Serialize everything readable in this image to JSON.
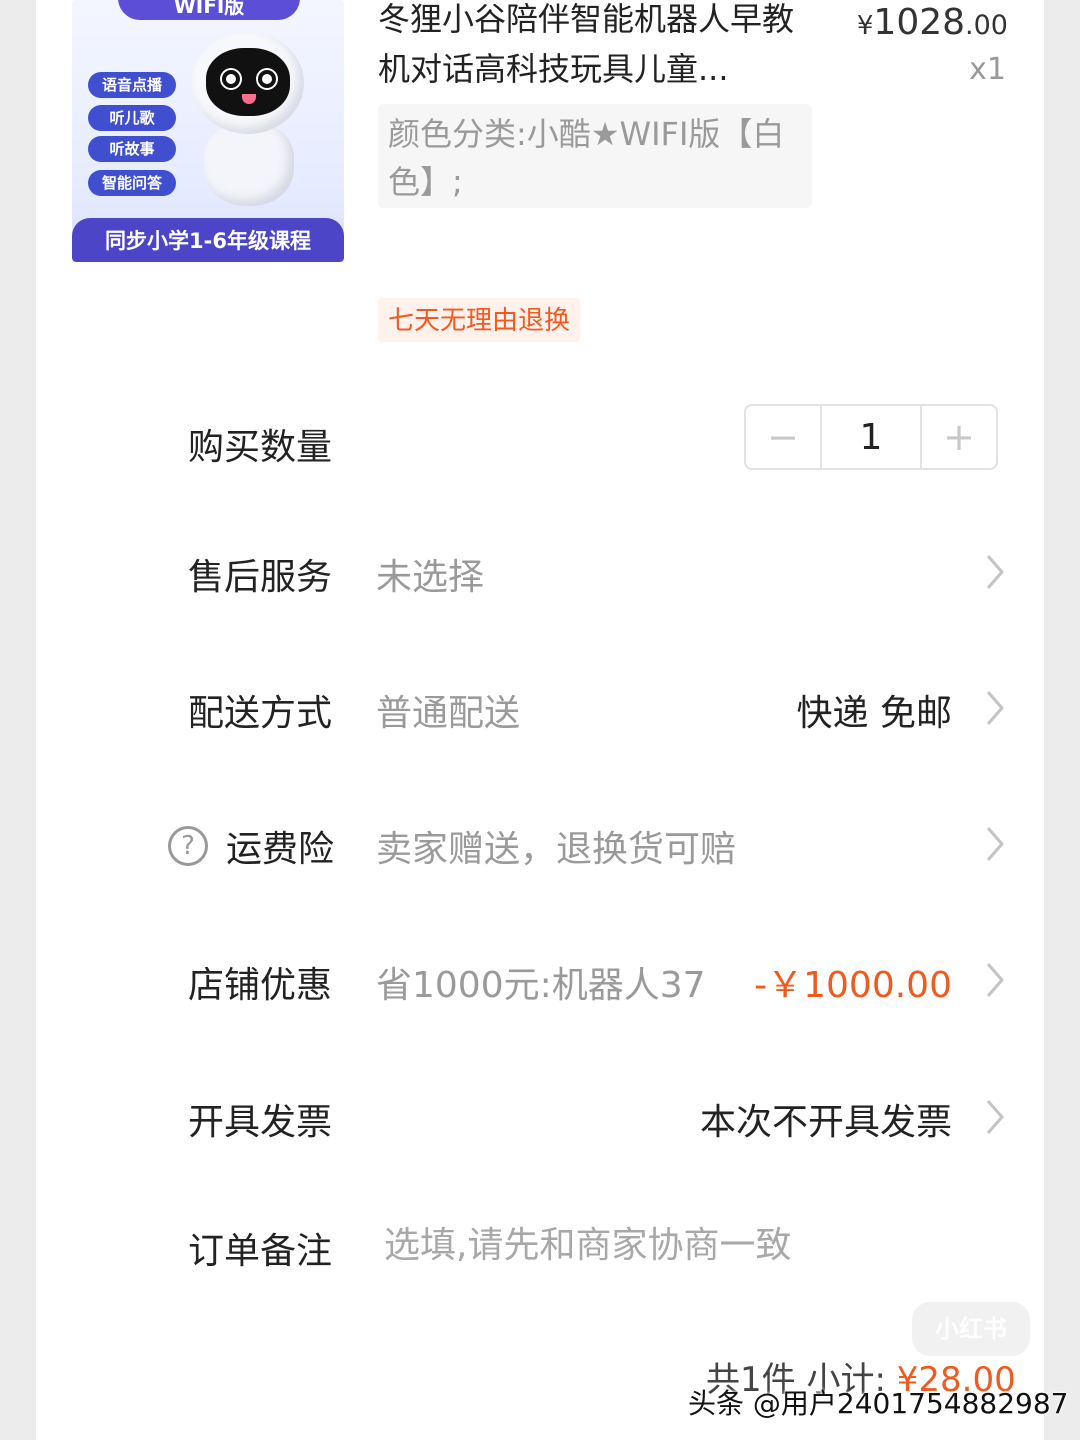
{
  "product": {
    "image": {
      "top_badge": "WIFI版",
      "tags": [
        "语音点播",
        "听儿歌",
        "听故事",
        "智能问答"
      ],
      "banner": "同步小学1-6年级课程"
    },
    "title": "冬狸小谷陪伴智能机器人早教机对话高科技玩具儿童...",
    "price_symbol": "¥",
    "price_int": "1028",
    "price_cents": ".00",
    "quantity_text": "x1",
    "spec": "颜色分类:小酷★WIFI版【白色】;",
    "return_badge": "七天无理由退换"
  },
  "rows": {
    "quantity": {
      "label": "购买数量",
      "value": "1",
      "minus": "−",
      "plus": "+"
    },
    "after_sales": {
      "label": "售后服务",
      "value": "未选择"
    },
    "delivery": {
      "label": "配送方式",
      "value": "普通配送",
      "right": "快递 免邮"
    },
    "shipping_insurance": {
      "label": "运费险",
      "value": "卖家赠送，退换货可赔",
      "help": "?"
    },
    "store_discount": {
      "label": "店铺优惠",
      "value": "省1000元:机器人37",
      "right": "-￥1000.00"
    },
    "invoice": {
      "label": "开具发票",
      "right": "本次不开具发票"
    },
    "order_note": {
      "label": "订单备注",
      "placeholder": "选填,请先和商家协商一致"
    }
  },
  "subtotal": {
    "count_text": "共1件",
    "label": "小计:",
    "amount": "¥28.00"
  },
  "watermarks": {
    "logo": "小红书",
    "credit": "头条 @用户2401754882987"
  },
  "colors": {
    "accent": "#ef5a1e",
    "badge_bg": "#fff1ec",
    "muted": "#9a9a9a"
  }
}
